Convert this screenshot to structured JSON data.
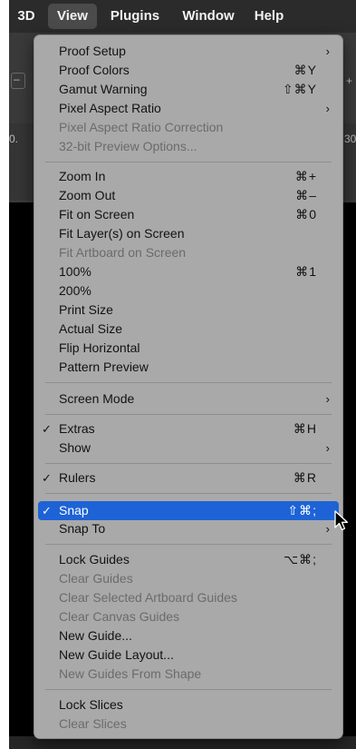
{
  "menubar": {
    "items": [
      {
        "label": "3D"
      },
      {
        "label": "View",
        "active": true
      },
      {
        "label": "Plugins"
      },
      {
        "label": "Window"
      },
      {
        "label": "Help"
      }
    ]
  },
  "background": {
    "edge_left_top": "–",
    "edge_left_mid": "0.",
    "edge_right_top": "+",
    "edge_right_mid": "30"
  },
  "menu": {
    "items": [
      {
        "label": "Proof Setup",
        "shortcut": "",
        "submenu": true,
        "enabled": true,
        "checked": false
      },
      {
        "label": "Proof Colors",
        "shortcut": "⌘Y",
        "submenu": false,
        "enabled": true,
        "checked": false
      },
      {
        "label": "Gamut Warning",
        "shortcut": "⇧⌘Y",
        "submenu": false,
        "enabled": true,
        "checked": false
      },
      {
        "label": "Pixel Aspect Ratio",
        "shortcut": "",
        "submenu": true,
        "enabled": true,
        "checked": false
      },
      {
        "label": "Pixel Aspect Ratio Correction",
        "shortcut": "",
        "submenu": false,
        "enabled": false,
        "checked": false
      },
      {
        "label": "32-bit Preview Options...",
        "shortcut": "",
        "submenu": false,
        "enabled": false,
        "checked": false
      },
      {
        "label": "Zoom In",
        "shortcut": "⌘+",
        "submenu": false,
        "enabled": true,
        "checked": false
      },
      {
        "label": "Zoom Out",
        "shortcut": "⌘–",
        "submenu": false,
        "enabled": true,
        "checked": false
      },
      {
        "label": "Fit on Screen",
        "shortcut": "⌘0",
        "submenu": false,
        "enabled": true,
        "checked": false
      },
      {
        "label": "Fit Layer(s) on Screen",
        "shortcut": "",
        "submenu": false,
        "enabled": true,
        "checked": false
      },
      {
        "label": "Fit Artboard on Screen",
        "shortcut": "",
        "submenu": false,
        "enabled": false,
        "checked": false
      },
      {
        "label": "100%",
        "shortcut": "⌘1",
        "submenu": false,
        "enabled": true,
        "checked": false
      },
      {
        "label": "200%",
        "shortcut": "",
        "submenu": false,
        "enabled": true,
        "checked": false
      },
      {
        "label": "Print Size",
        "shortcut": "",
        "submenu": false,
        "enabled": true,
        "checked": false
      },
      {
        "label": "Actual Size",
        "shortcut": "",
        "submenu": false,
        "enabled": true,
        "checked": false
      },
      {
        "label": "Flip Horizontal",
        "shortcut": "",
        "submenu": false,
        "enabled": true,
        "checked": false
      },
      {
        "label": "Pattern Preview",
        "shortcut": "",
        "submenu": false,
        "enabled": true,
        "checked": false
      },
      {
        "label": "Screen Mode",
        "shortcut": "",
        "submenu": true,
        "enabled": true,
        "checked": false
      },
      {
        "label": "Extras",
        "shortcut": "⌘H",
        "submenu": false,
        "enabled": true,
        "checked": true
      },
      {
        "label": "Show",
        "shortcut": "",
        "submenu": true,
        "enabled": true,
        "checked": false
      },
      {
        "label": "Rulers",
        "shortcut": "⌘R",
        "submenu": false,
        "enabled": true,
        "checked": true
      },
      {
        "label": "Snap",
        "shortcut": "⇧⌘;",
        "submenu": false,
        "enabled": true,
        "checked": true,
        "highlighted": true
      },
      {
        "label": "Snap To",
        "shortcut": "",
        "submenu": true,
        "enabled": true,
        "checked": false
      },
      {
        "label": "Lock Guides",
        "shortcut": "⌥⌘;",
        "submenu": false,
        "enabled": true,
        "checked": false
      },
      {
        "label": "Clear Guides",
        "shortcut": "",
        "submenu": false,
        "enabled": false,
        "checked": false
      },
      {
        "label": "Clear Selected Artboard Guides",
        "shortcut": "",
        "submenu": false,
        "enabled": false,
        "checked": false
      },
      {
        "label": "Clear Canvas Guides",
        "shortcut": "",
        "submenu": false,
        "enabled": false,
        "checked": false
      },
      {
        "label": "New Guide...",
        "shortcut": "",
        "submenu": false,
        "enabled": true,
        "checked": false
      },
      {
        "label": "New Guide Layout...",
        "shortcut": "",
        "submenu": false,
        "enabled": true,
        "checked": false
      },
      {
        "label": "New Guides From Shape",
        "shortcut": "",
        "submenu": false,
        "enabled": false,
        "checked": false
      },
      {
        "label": "Lock Slices",
        "shortcut": "",
        "submenu": false,
        "enabled": true,
        "checked": false
      },
      {
        "label": "Clear Slices",
        "shortcut": "",
        "submenu": false,
        "enabled": false,
        "checked": false
      }
    ]
  },
  "glyphs": {
    "check": "✓",
    "submenu_arrow": "›"
  },
  "colors": {
    "menu_bg": "#a9a9a9",
    "highlight": "#1d63d6",
    "menubar_bg": "#2b2b2b"
  }
}
